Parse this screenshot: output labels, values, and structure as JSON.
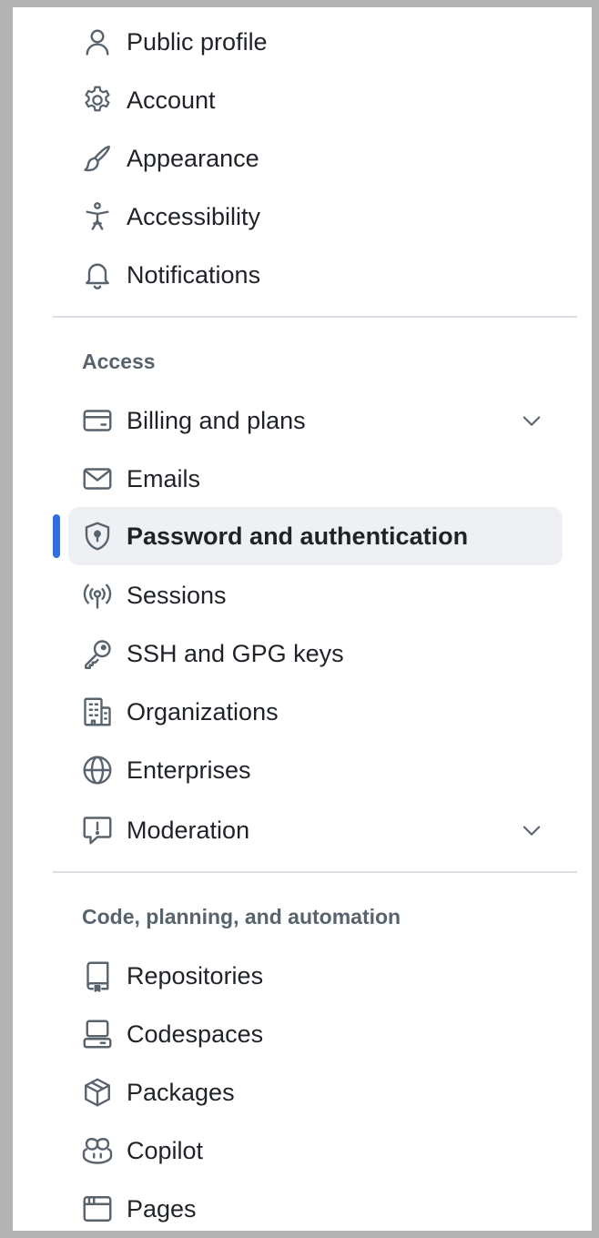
{
  "colors": {
    "accent": "#2f6fde",
    "active_bg": "#eef0f3",
    "text": "#1f2328",
    "muted": "#59636e",
    "divider": "#d8dee4"
  },
  "top_items": [
    {
      "label": "Public profile",
      "icon": "person-icon"
    },
    {
      "label": "Account",
      "icon": "gear-icon"
    },
    {
      "label": "Appearance",
      "icon": "paintbrush-icon"
    },
    {
      "label": "Accessibility",
      "icon": "accessibility-icon"
    },
    {
      "label": "Notifications",
      "icon": "bell-icon"
    }
  ],
  "access": {
    "heading": "Access",
    "items": [
      {
        "label": "Billing and plans",
        "icon": "credit-card-icon",
        "expandable": true
      },
      {
        "label": "Emails",
        "icon": "mail-icon"
      },
      {
        "label": "Password and authentication",
        "icon": "shield-lock-icon",
        "active": true
      },
      {
        "label": "Sessions",
        "icon": "broadcast-icon"
      },
      {
        "label": "SSH and GPG keys",
        "icon": "key-icon"
      },
      {
        "label": "Organizations",
        "icon": "organization-icon"
      },
      {
        "label": "Enterprises",
        "icon": "globe-icon"
      },
      {
        "label": "Moderation",
        "icon": "report-icon",
        "expandable": true
      }
    ]
  },
  "code": {
    "heading": "Code, planning, and automation",
    "items": [
      {
        "label": "Repositories",
        "icon": "repo-icon"
      },
      {
        "label": "Codespaces",
        "icon": "codespaces-icon"
      },
      {
        "label": "Packages",
        "icon": "package-icon"
      },
      {
        "label": "Copilot",
        "icon": "copilot-icon"
      },
      {
        "label": "Pages",
        "icon": "browser-icon"
      }
    ]
  }
}
